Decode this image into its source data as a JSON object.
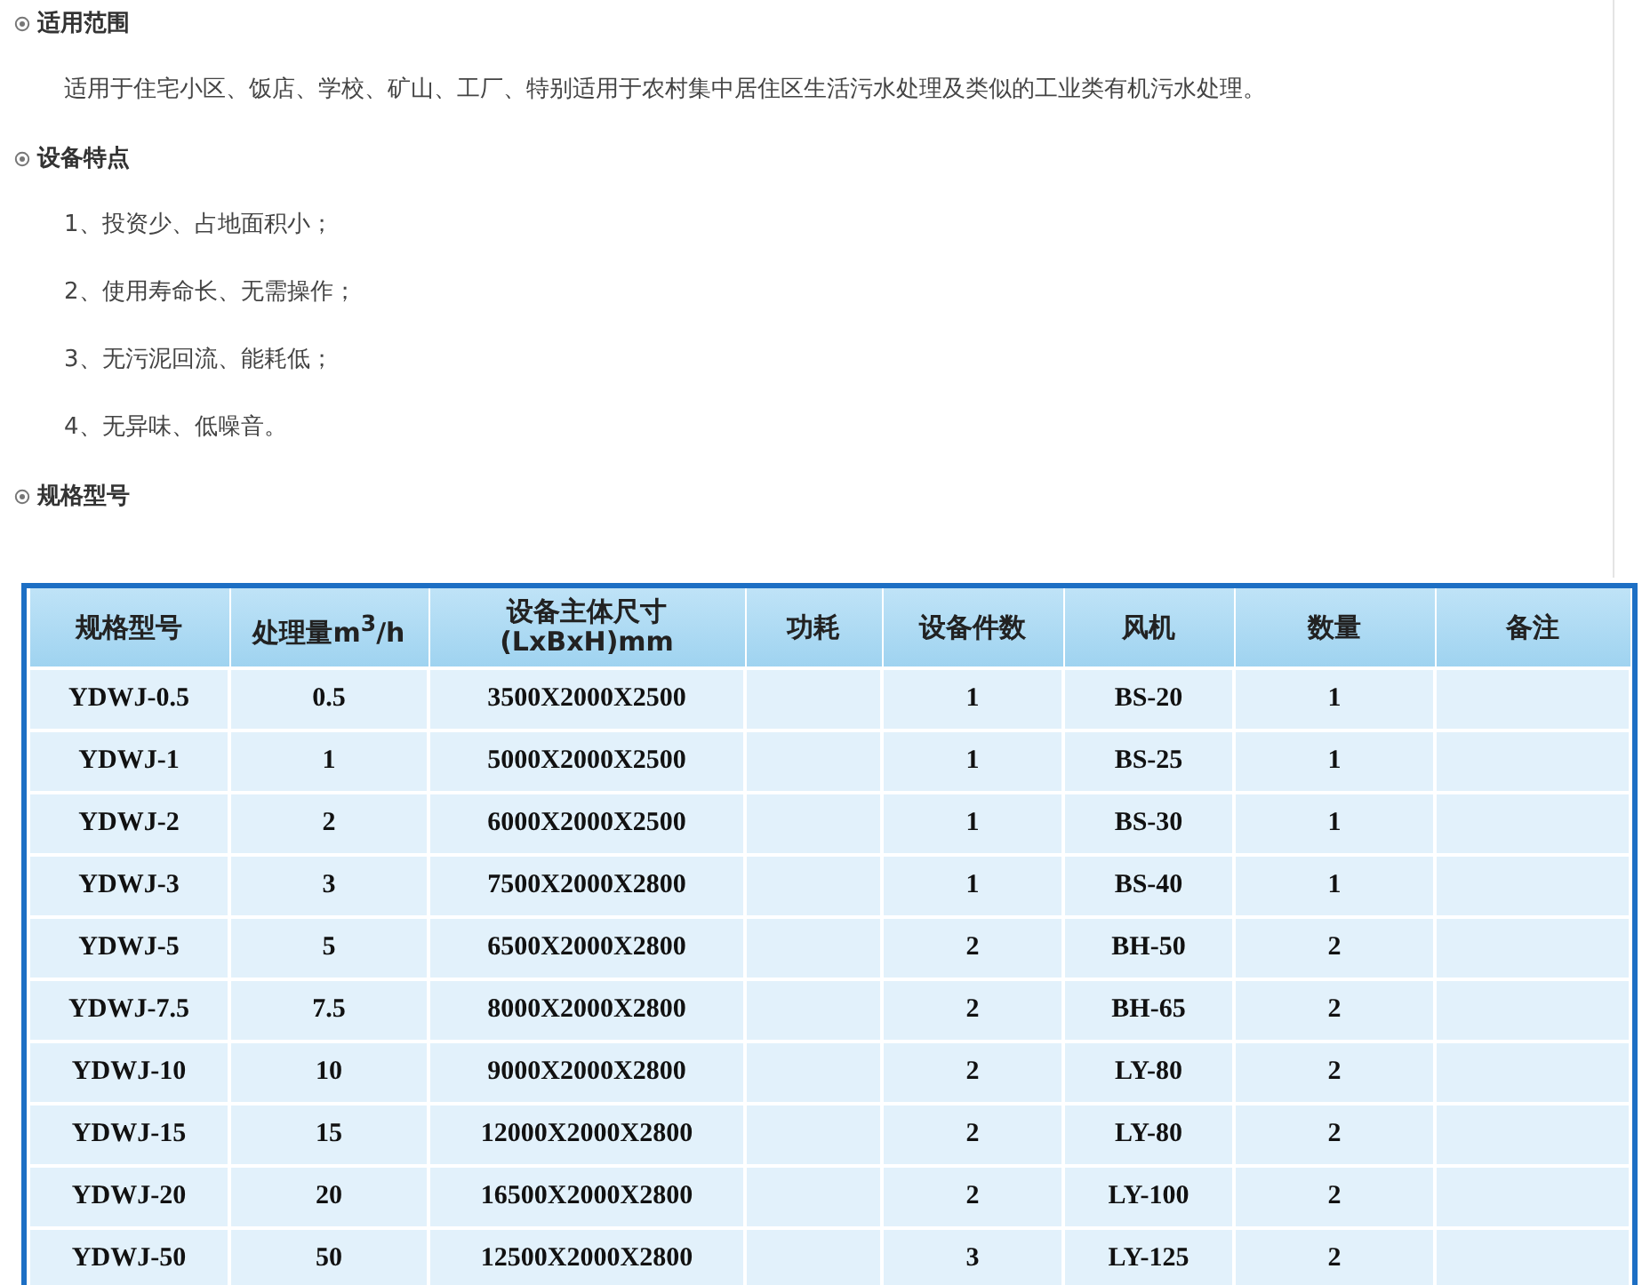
{
  "sections": [
    {
      "heading": "适用范围",
      "paragraphs": [
        "适用于住宅小区、饭店、学校、矿山、工厂、特别适用于农村集中居住区生活污水处理及类似的工业类有机污水处理。"
      ]
    },
    {
      "heading": "设备特点",
      "paragraphs": [
        "1、投资少、占地面积小；",
        "2、使用寿命长、无需操作；",
        "3、无污泥回流、能耗低；",
        "4、无异味、低噪音。"
      ]
    },
    {
      "heading": "规格型号"
    }
  ],
  "table": {
    "columns": [
      "规格型号",
      "处理量m$^{3}$/h",
      "设备主体尺寸\n(LxBxH)mm",
      "功耗",
      "设备件数",
      "风机",
      "数量",
      "备注"
    ],
    "rows": [
      [
        "YDWJ-0.5",
        "0.5",
        "3500X2000X2500",
        "",
        "1",
        "BS-20",
        "1",
        ""
      ],
      [
        "YDWJ-1",
        "1",
        "5000X2000X2500",
        "",
        "1",
        "BS-25",
        "1",
        ""
      ],
      [
        "YDWJ-2",
        "2",
        "6000X2000X2500",
        "",
        "1",
        "BS-30",
        "1",
        ""
      ],
      [
        "YDWJ-3",
        "3",
        "7500X2000X2800",
        "",
        "1",
        "BS-40",
        "1",
        ""
      ],
      [
        "YDWJ-5",
        "5",
        "6500X2000X2800",
        "",
        "2",
        "BH-50",
        "2",
        ""
      ],
      [
        "YDWJ-7.5",
        "7.5",
        "8000X2000X2800",
        "",
        "2",
        "BH-65",
        "2",
        ""
      ],
      [
        "YDWJ-10",
        "10",
        "9000X2000X2800",
        "",
        "2",
        "LY-80",
        "2",
        ""
      ],
      [
        "YDWJ-15",
        "15",
        "12000X2000X2800",
        "",
        "2",
        "LY-80",
        "2",
        ""
      ],
      [
        "YDWJ-20",
        "20",
        "16500X2000X2800",
        "",
        "2",
        "LY-100",
        "2",
        ""
      ],
      [
        "YDWJ-50",
        "50",
        "12500X2000X2800",
        "",
        "3",
        "LY-125",
        "2",
        ""
      ]
    ]
  }
}
